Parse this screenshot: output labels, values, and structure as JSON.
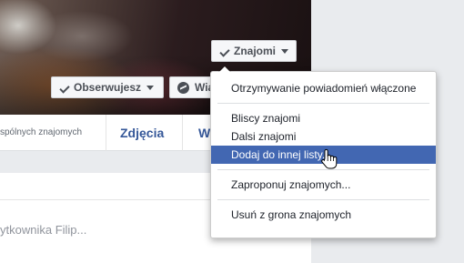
{
  "profile": {
    "friends_button": "Znajomi",
    "follow_button": "Obserwujesz",
    "message_button": "Wia",
    "mutual_friends": "spólnych znajomych",
    "tabs": {
      "photos": "Zdjęcia",
      "next": "W"
    },
    "post_placeholder": "ytkownika Filip..."
  },
  "menu": {
    "items": [
      "Otrzymywanie powiadomień włączone",
      "Bliscy znajomi",
      "Dalsi znajomi",
      "Dodaj do innej listy...",
      "Zaproponuj znajomych...",
      "Usuń z grona znajomych"
    ],
    "active_index": 3
  },
  "colors": {
    "accent": "#4267b2",
    "link": "#365899",
    "background": "#e9ebee"
  }
}
